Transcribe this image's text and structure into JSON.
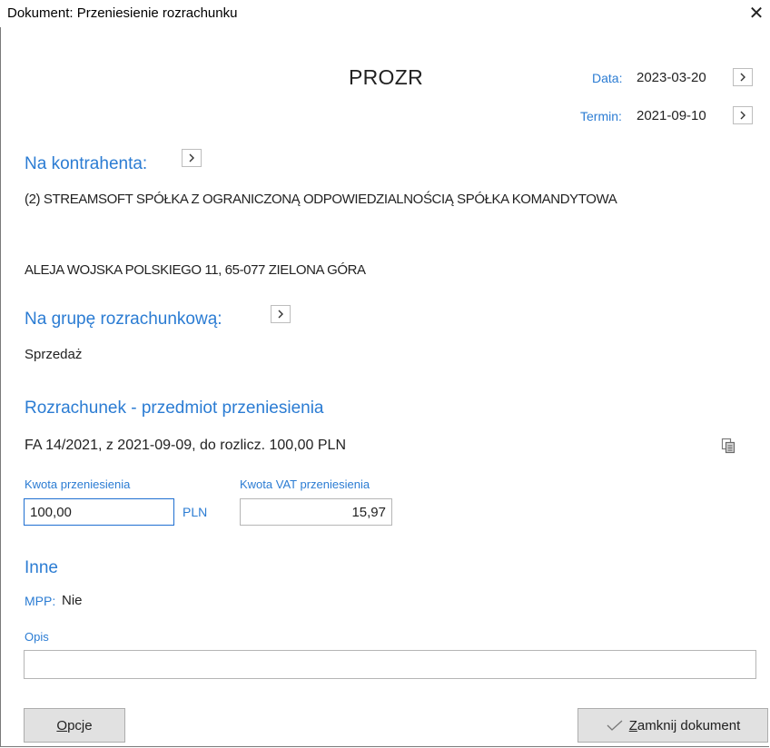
{
  "window": {
    "title": "Dokument: Przeniesienie rozrachunku",
    "close_glyph": "✕"
  },
  "document": {
    "code": "PROZR",
    "date_label": "Data:",
    "date_value": "2023-03-20",
    "due_label": "Termin:",
    "due_value": "2021-09-10"
  },
  "contractor": {
    "heading": "Na kontrahenta:",
    "name": "(2) STREAMSOFT SPÓŁKA Z OGRANICZONĄ ODPOWIEDZIALNOŚCIĄ SPÓŁKA KOMANDYTOWA",
    "address": "ALEJA WOJSKA POLSKIEGO 11, 65-077 ZIELONA GÓRA"
  },
  "group": {
    "heading": "Na grupę rozrachunkową:",
    "value": "Sprzedaż"
  },
  "settlement": {
    "heading": "Rozrachunek - przedmiot przeniesienia",
    "description": "FA 14/2021, z 2021-09-09, do rozlicz. 100,00 PLN",
    "amount_label": "Kwota przeniesienia",
    "amount_value": "100,00",
    "currency": "PLN",
    "vat_label": "Kwota VAT przeniesienia",
    "vat_value": "15,97"
  },
  "other": {
    "heading": "Inne",
    "mpp_label": "MPP:",
    "mpp_value": "Nie",
    "description_label": "Opis",
    "description_value": ""
  },
  "buttons": {
    "options_label": "Opcje",
    "close_doc_label": "Zamknij dokument"
  },
  "icons": {
    "arrow": "chevron-right-icon",
    "copy": "copy-document-icon",
    "check": "checkmark-icon"
  }
}
